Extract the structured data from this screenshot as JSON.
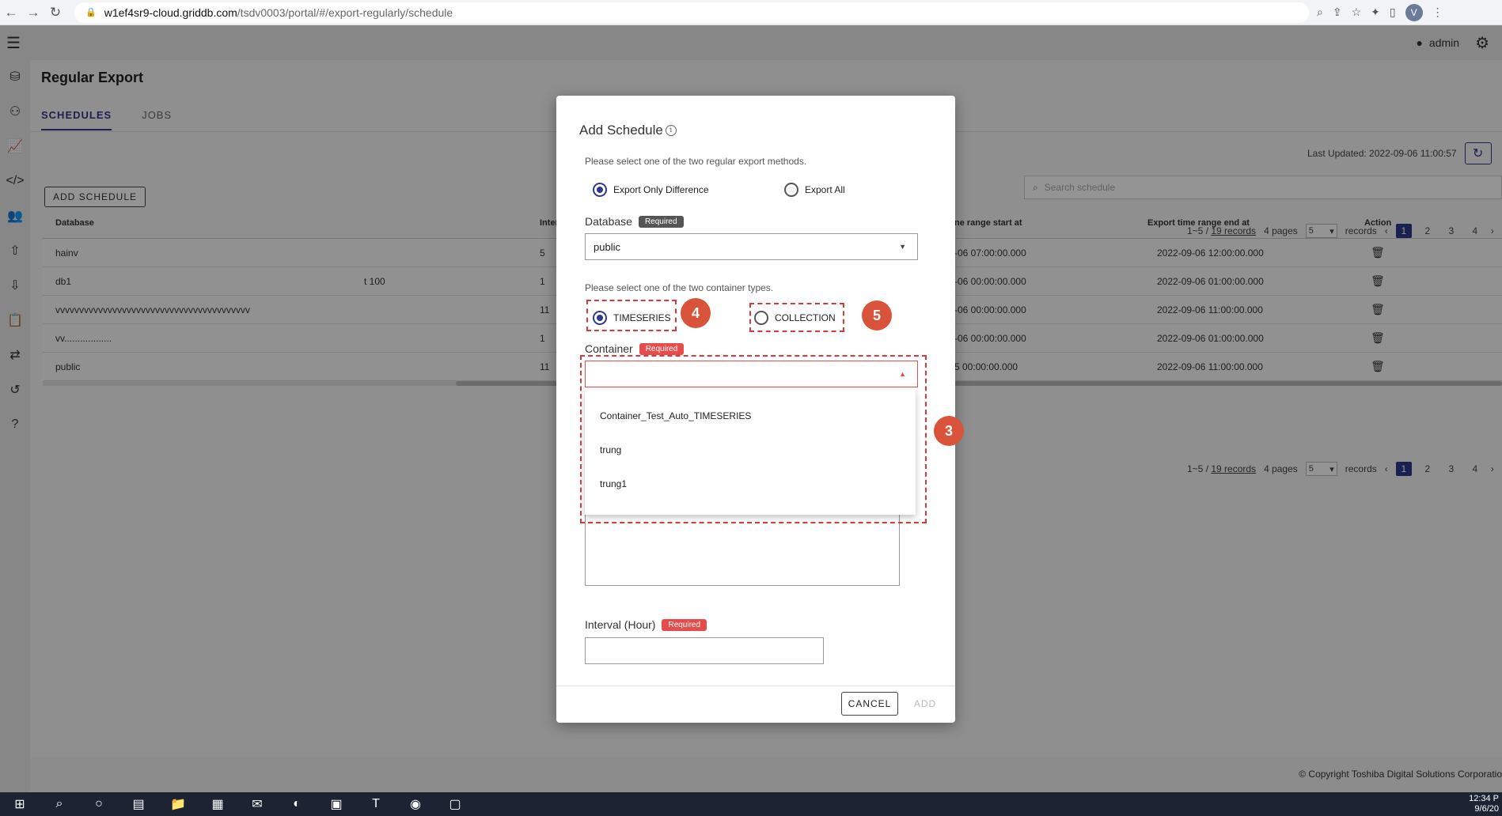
{
  "browser": {
    "url_host": "w1ef4sr9-cloud.griddb.com",
    "url_path": "/tsdv0003/portal/#/export-regularly/schedule",
    "profile_initial": "V"
  },
  "header": {
    "user": "admin"
  },
  "page": {
    "title": "Regular Export",
    "tabs": [
      "SCHEDULES",
      "JOBS"
    ],
    "add_schedule_label": "ADD SCHEDULE",
    "last_updated": "Last Updated: 2022-09-06 11:00:57",
    "search_placeholder": "Search schedule"
  },
  "pager": {
    "range": "1~5 / ",
    "records_link": "19 records",
    "pages": "4 pages",
    "per_page": "5",
    "records_suffix": "records",
    "page_numbers": [
      "1",
      "2",
      "3",
      "4"
    ]
  },
  "table": {
    "columns": [
      "Database",
      "Inter",
      "ne range start at",
      "Export time range end at",
      "Action"
    ],
    "rows": [
      {
        "database": "hainv",
        "container": "",
        "interval": "5",
        "start": "-06 07:00:00.000",
        "end": "2022-09-06 12:00:00.000"
      },
      {
        "database": "db1",
        "container": "t 100",
        "interval": "1",
        "start": "-06 00:00:00.000",
        "end": "2022-09-06 01:00:00.000"
      },
      {
        "database": "vvvvvvvvvvvvvvvvvvvvvvvvvvvvvvvvvvvvvvvvv",
        "container": "",
        "interval": "11",
        "start": "-06 00:00:00.000",
        "end": "2022-09-06 11:00:00.000"
      },
      {
        "database": "vv..................",
        "container": "",
        "interval": "1",
        "start": "-06 00:00:00.000",
        "end": "2022-09-06 01:00:00.000"
      },
      {
        "database": "public",
        "container": "",
        "interval": "11",
        "start": "5 00:00:00.000",
        "end": "2022-09-06 11:00:00.000"
      }
    ]
  },
  "footer": {
    "copyright": "© Copyright Toshiba Digital Solutions Corporatio"
  },
  "dialog": {
    "title": "Add Schedule",
    "method_prompt": "Please select one of the two regular export methods.",
    "method_options": [
      "Export Only Difference",
      "Export All"
    ],
    "database_label": "Database",
    "required": "Required",
    "database_value": "public",
    "container_type_prompt": "Please select one of the two container types.",
    "container_types": [
      "TIMESERIES",
      "COLLECTION"
    ],
    "container_label": "Container",
    "container_options": [
      "Container_Test_Auto_TIMESERIES",
      "trung",
      "trung1"
    ],
    "interval_label": "Interval (Hour)",
    "cancel_label": "CANCEL",
    "add_label": "ADD"
  },
  "callouts": [
    "3",
    "4",
    "5"
  ],
  "taskbar": {
    "time": "12:34 P",
    "date": "9/6/20"
  },
  "colors": {
    "accent": "#2d3a8c",
    "required": "#e74c4c",
    "callout": "#d9533a"
  }
}
